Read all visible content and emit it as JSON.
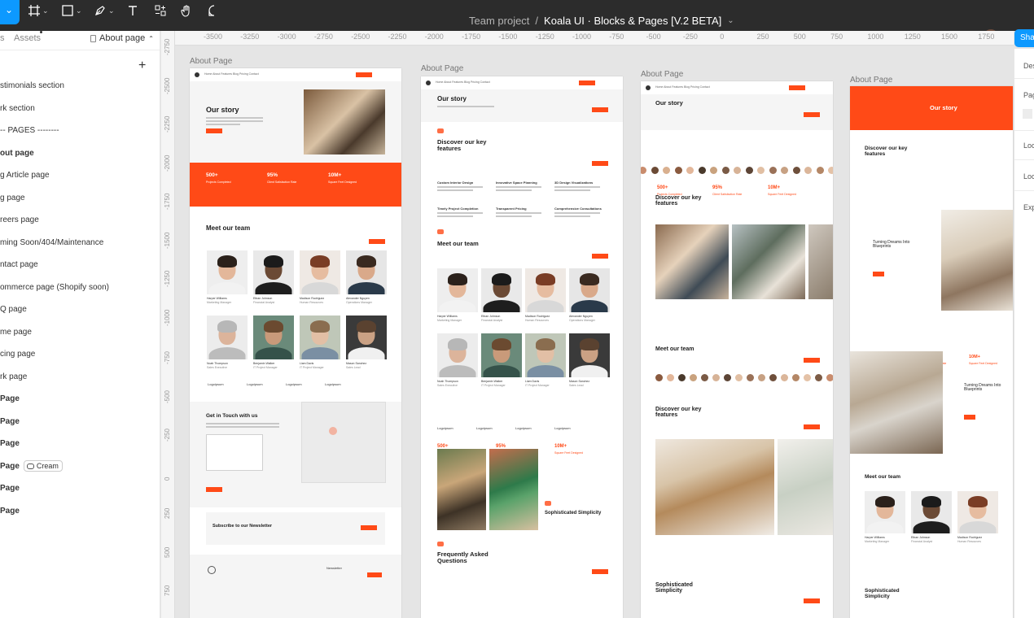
{
  "toolbar": {
    "breadcrumb_project": "Team project",
    "breadcrumb_separator": "/",
    "file_name": "Koala UI · Blocks & Pages [V.2 BETA]",
    "share_label": "Shar",
    "icons": [
      "move-icon",
      "frame-icon",
      "shape-icon",
      "pen-icon",
      "text-icon",
      "resources-icon",
      "hand-icon",
      "comment-icon"
    ]
  },
  "sidebar": {
    "tab_layers": "s",
    "tab_assets": "Assets",
    "page_selector": "About page",
    "add_label": "+",
    "items": [
      {
        "label": "stimonials section",
        "bold": false
      },
      {
        "label": "rk section",
        "bold": false
      },
      {
        "label": "--  PAGES  --------",
        "bold": false,
        "separator": true
      },
      {
        "label": "out page",
        "bold": true
      },
      {
        "label": "g Article page",
        "bold": false
      },
      {
        "label": "g page",
        "bold": false
      },
      {
        "label": "reers page",
        "bold": false
      },
      {
        "label": "ming Soon/404/Maintenance",
        "bold": false
      },
      {
        "label": "ntact page",
        "bold": false
      },
      {
        "label": "ommerce page (Shopify soon)",
        "bold": false
      },
      {
        "label": "Q page",
        "bold": false
      },
      {
        "label": "me page",
        "bold": false
      },
      {
        "label": "cing page",
        "bold": false
      },
      {
        "label": "rk page",
        "bold": false
      },
      {
        "label": "Page",
        "bold": true
      },
      {
        "label": "Page",
        "bold": true
      },
      {
        "label": "Page",
        "bold": true
      },
      {
        "label": "Page",
        "bold": true,
        "badge": "Cream"
      },
      {
        "label": "Page",
        "bold": true
      },
      {
        "label": "Page",
        "bold": true
      }
    ]
  },
  "right_panel": {
    "items": [
      "Des",
      "Pag",
      "Loc",
      "Loc",
      "Exp"
    ]
  },
  "ruler": {
    "x_ticks": [
      "-3500",
      "-3250",
      "-3000",
      "-2750",
      "-2500",
      "-2250",
      "-2000",
      "-1750",
      "-1500",
      "-1250",
      "-1000",
      "-750",
      "-500",
      "-250",
      "0",
      "250",
      "500",
      "750",
      "1000",
      "1250",
      "1500",
      "1750",
      "2000"
    ],
    "y_ticks": [
      "-2750",
      "-2500",
      "-2250",
      "-2000",
      "-1750",
      "-1500",
      "-1250",
      "-1000",
      "-750",
      "-500",
      "-250",
      "0",
      "250",
      "500",
      "750"
    ]
  },
  "frames": [
    {
      "label": "About Page",
      "nav_links": "Home  About  Features  Blog  Pricing  Contact",
      "hero_title": "Our story",
      "stats": [
        {
          "n": "500+",
          "l": "Projects Completed"
        },
        {
          "n": "95%",
          "l": "Client Satisfaction Rate"
        },
        {
          "n": "10M+",
          "l": "Square Feet Designed"
        }
      ],
      "team_title": "Meet our team",
      "team": [
        {
          "name": "Harper Williams",
          "role": "Marketing Manager"
        },
        {
          "name": "Ethan Johnson",
          "role": "Financial Analyst"
        },
        {
          "name": "Madison Rodriguez",
          "role": "Human Resources"
        },
        {
          "name": "Alexander Nguyen",
          "role": "Operations Manager"
        },
        {
          "name": "Noah Thompson",
          "role": "Sales Executive"
        },
        {
          "name": "Benjamin Walker",
          "role": "IT Project Manager"
        },
        {
          "name": "Liam Davis",
          "role": "IT Project Manager"
        },
        {
          "name": "Mason Sanchez",
          "role": "Sales Lead"
        }
      ],
      "logos": [
        "Logoipsum",
        "Logoipsum",
        "Logoipsum",
        "Logoipsum"
      ],
      "contact_title": "Get in Touch with us",
      "newsletter_title": "Subscribe to our Newsletter",
      "footer_newsletter": "Newsletter"
    },
    {
      "label": "About Page",
      "hero_title": "Our story",
      "features_title": "Discover our key features",
      "features": [
        "Custom Interior Design",
        "Innovative Space Planning",
        "3D Design Visualizations",
        "Timely Project Completion",
        "Transparent Pricing",
        "Comprehensive Consultations"
      ],
      "team_title": "Meet our team",
      "stats": [
        {
          "n": "500+",
          "l": "Projects Completed"
        },
        {
          "n": "95%",
          "l": "Client Satisfaction Rate"
        },
        {
          "n": "10M+",
          "l": "Square Feet Designed"
        }
      ],
      "simplicity_title": "Sophisticated Simplicity",
      "faq_title": "Frequently Asked Questions"
    },
    {
      "label": "About Page",
      "hero_title": "Our story",
      "stats": [
        {
          "n": "500+",
          "l": "Projects Completed"
        },
        {
          "n": "95%",
          "l": "Client Satisfaction Rate"
        },
        {
          "n": "10M+",
          "l": "Square Feet Designed"
        }
      ],
      "features_title": "Discover our key features",
      "team_title": "Meet our team",
      "features_title_2": "Discover our key features",
      "simplicity_title": "Sophisticated Simplicity"
    },
    {
      "label": "About Page",
      "hero_title": "Our story",
      "features_title": "Discover our key features",
      "dreams_title": "Turning Dreams Into Blueprints",
      "stats": [
        {
          "n": "500+",
          "l": "Projects Completed"
        },
        {
          "n": "95%",
          "l": "Client Satisfaction Rate"
        },
        {
          "n": "10M+",
          "l": "Square Feet Designed"
        }
      ],
      "dreams_title_2": "Turning Dreams Into Blueprints",
      "team_title": "Meet our team",
      "simplicity_title": "Sophisticated Simplicity"
    }
  ]
}
